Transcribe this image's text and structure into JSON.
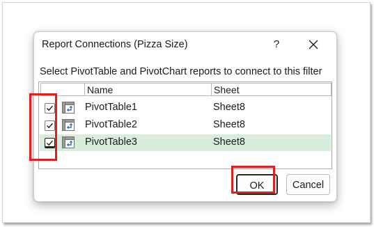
{
  "dialog": {
    "title": "Report Connections (Pizza Size)",
    "help_label": "?",
    "instruction": "Select PivotTable and PivotChart reports to connect to this filter"
  },
  "list": {
    "columns": {
      "name": "Name",
      "sheet": "Sheet"
    },
    "rows": [
      {
        "checked": true,
        "name": "PivotTable1",
        "sheet": "Sheet8",
        "selected": false
      },
      {
        "checked": true,
        "name": "PivotTable2",
        "sheet": "Sheet8",
        "selected": false
      },
      {
        "checked": true,
        "name": "PivotTable3",
        "sheet": "Sheet8",
        "selected": true
      }
    ]
  },
  "buttons": {
    "ok": "OK",
    "cancel": "Cancel"
  },
  "colors": {
    "highlight": "#e02020",
    "selected_row": "#d7eedd"
  },
  "icons": {
    "close": "close-icon",
    "checkmark": "checkmark-icon",
    "pivottable": "pivottable-icon"
  }
}
